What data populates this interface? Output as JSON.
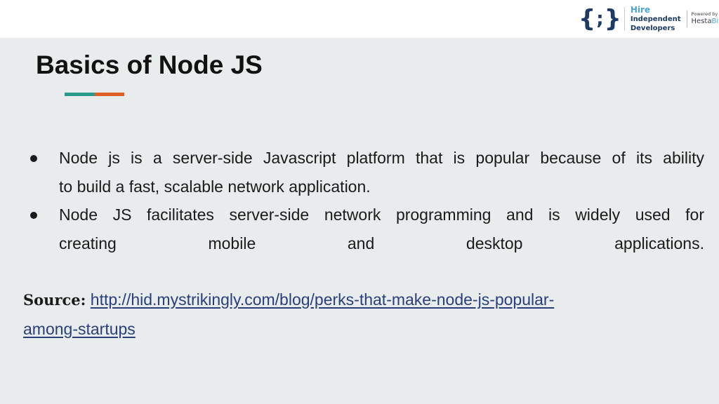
{
  "header": {
    "logo": {
      "braces_icon": "{;}",
      "line1": "Hire",
      "line2": "Independent",
      "line3": "Developers",
      "powered_by": "Powered by",
      "brand_main": "Hesta",
      "brand_accent": "Bit"
    }
  },
  "slide": {
    "title": "Basics of Node JS",
    "accent_colors": [
      "#2a9a8c",
      "#dc5f26"
    ],
    "bullets": [
      {
        "line1": "Node js is a server-side Javascript platform that is popular because of its ability",
        "line2": "to build a fast, scalable network application."
      },
      {
        "line1": "Node JS facilitates server-side network programming and is widely used for",
        "line2": "creating mobile and desktop applications."
      }
    ],
    "source": {
      "label": "Source:",
      "link_text": "http://hid.mystrikingly.com/blog/perks-that-make-node-js-popular-among-startups",
      "link_line1": "http://hid.mystrikingly.com/blog/perks-that-make-node-js-popular-",
      "link_line2": "among-startups"
    }
  }
}
